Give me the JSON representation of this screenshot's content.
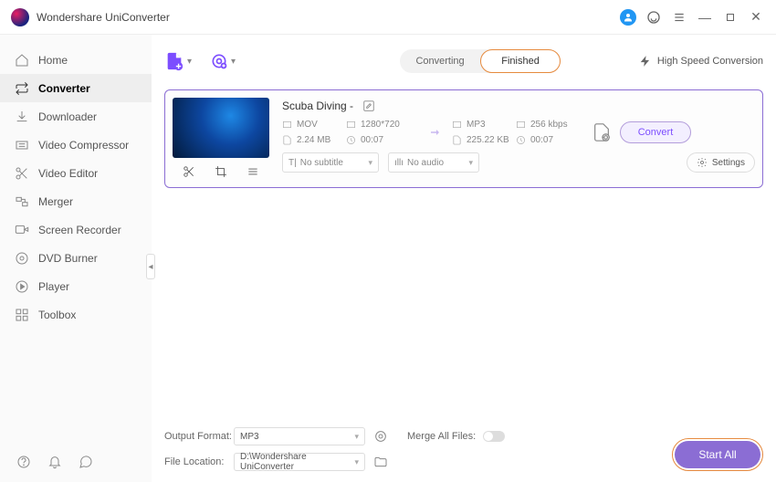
{
  "app": {
    "title": "Wondershare UniConverter"
  },
  "sidebar": {
    "items": [
      {
        "label": "Home"
      },
      {
        "label": "Converter"
      },
      {
        "label": "Downloader"
      },
      {
        "label": "Video Compressor"
      },
      {
        "label": "Video Editor"
      },
      {
        "label": "Merger"
      },
      {
        "label": "Screen Recorder"
      },
      {
        "label": "DVD Burner"
      },
      {
        "label": "Player"
      },
      {
        "label": "Toolbox"
      }
    ]
  },
  "toolbar": {
    "tab_converting": "Converting",
    "tab_finished": "Finished",
    "high_speed": "High Speed Conversion"
  },
  "file": {
    "name": "Scuba Diving -",
    "src": {
      "format": "MOV",
      "resolution": "1280*720",
      "size": "2.24 MB",
      "duration": "00:07"
    },
    "dst": {
      "format": "MP3",
      "bitrate": "256 kbps",
      "size": "225.22 KB",
      "duration": "00:07"
    },
    "convert_label": "Convert",
    "subtitle_value": "No subtitle",
    "audio_value": "No audio",
    "settings_label": "Settings"
  },
  "footer": {
    "output_format_label": "Output Format:",
    "output_format_value": "MP3",
    "file_location_label": "File Location:",
    "file_location_value": "D:\\Wondershare UniConverter",
    "merge_label": "Merge All Files:",
    "start_all": "Start All"
  }
}
